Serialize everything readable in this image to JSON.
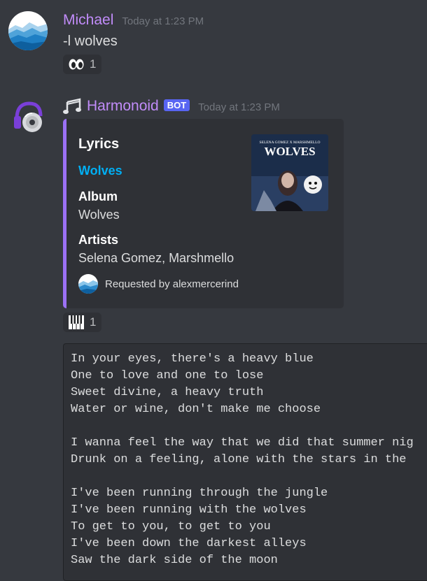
{
  "messages": [
    {
      "username": "Michael",
      "timestamp": "Today at 1:23 PM",
      "content": "-l wolves",
      "reaction": {
        "icon": "eyes-emoji-icon",
        "count": "1"
      }
    },
    {
      "username": "Harmonoid",
      "badge": "BOT",
      "timestamp": "Today at 1:23 PM",
      "embed": {
        "title": "Lyrics",
        "link": "Wolves",
        "fields": [
          {
            "name": "Album",
            "value": "Wolves"
          },
          {
            "name": "Artists",
            "value": "Selena Gomez, Marshmello"
          }
        ],
        "footer": "Requested by alexmercerind",
        "thumbnail": {
          "top_text": "SELENA GOMEZ X MARSHMELLO",
          "title": "WOLVES"
        }
      },
      "reaction": {
        "icon": "piano-keys-emoji-icon",
        "count": "1"
      },
      "lyrics": [
        "In your eyes, there's a heavy blue",
        "One to love and one to lose",
        "Sweet divine, a heavy truth",
        "Water or wine, don't make me choose",
        "",
        "I wanna feel the way that we did that summer nig",
        "Drunk on a feeling, alone with the stars in the",
        "",
        "I've been running through the jungle",
        "I've been running with the wolves",
        "To get to you, to get to you",
        "I've been down the darkest alleys",
        "Saw the dark side of the moon"
      ]
    }
  ],
  "colors": {
    "background": "#36393f",
    "embed_bg": "#2f3136",
    "embed_accent": "#9b71f5",
    "username": "#c18cf9",
    "link": "#00aff4",
    "bot_badge": "#5865f2"
  }
}
